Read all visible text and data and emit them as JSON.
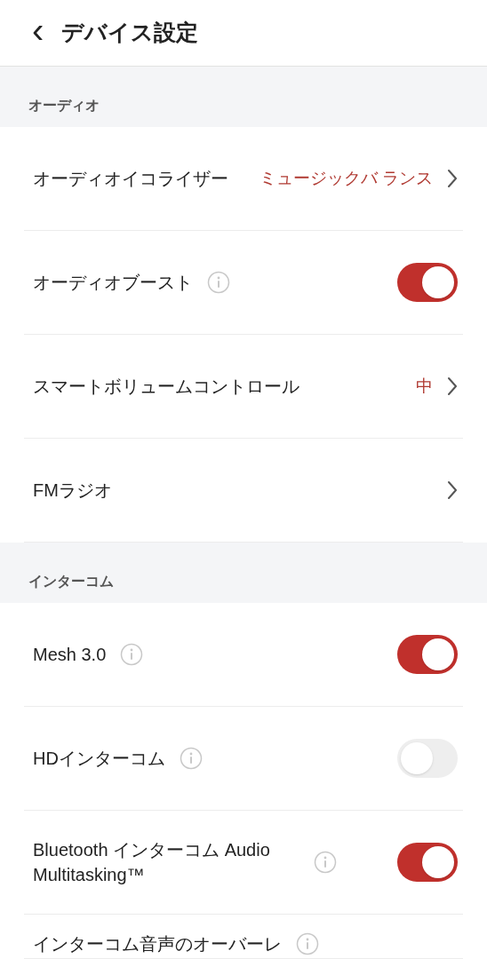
{
  "header": {
    "back": "‹",
    "title": "デバイス設定"
  },
  "sections": [
    {
      "title": "オーディオ",
      "items": [
        {
          "kind": "link",
          "label": "オーディオイコライザー",
          "value": "ミュージックバ ランス",
          "info": false
        },
        {
          "kind": "toggle",
          "label": "オーディオブースト",
          "info": true,
          "on": true
        },
        {
          "kind": "link",
          "label": "スマートボリュームコントロール",
          "value": "中",
          "info": false
        },
        {
          "kind": "link",
          "label": "FMラジオ",
          "info": false
        }
      ]
    },
    {
      "title": "インターコム",
      "items": [
        {
          "kind": "toggle",
          "label": "Mesh 3.0",
          "info": true,
          "on": true
        },
        {
          "kind": "toggle",
          "label": "HDインターコム",
          "info": true,
          "on": false
        },
        {
          "kind": "toggle",
          "label": "Bluetooth インターコム Audio Multitasking™",
          "info": true,
          "on": true
        },
        {
          "kind": "cut",
          "label": "インターコム音声のオーバーレ",
          "info": true
        }
      ]
    }
  ]
}
